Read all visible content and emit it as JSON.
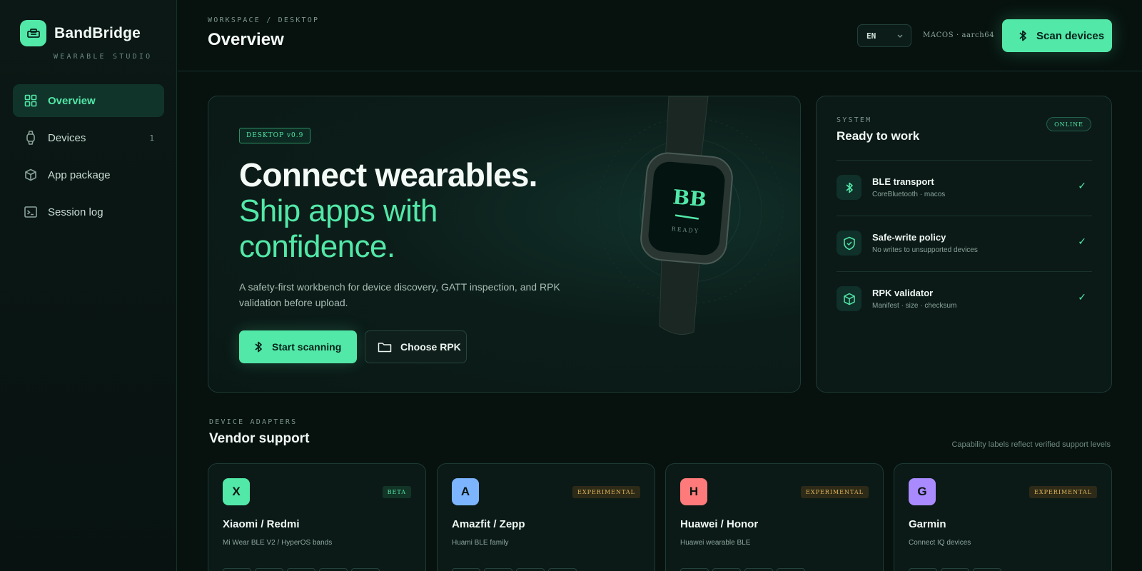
{
  "brand": {
    "name": "BandBridge",
    "subtitle": "WEARABLE STUDIO"
  },
  "sidebar": {
    "items": [
      {
        "label": "Overview",
        "icon": "grid-icon",
        "active": true
      },
      {
        "label": "Devices",
        "icon": "watch-icon",
        "count": "1"
      },
      {
        "label": "App package",
        "icon": "package-icon"
      },
      {
        "label": "Session log",
        "icon": "terminal-icon"
      }
    ]
  },
  "header": {
    "breadcrumb": "WORKSPACE / DESKTOP",
    "title": "Overview",
    "language": "EN",
    "platform": "MACOS · aarch64",
    "scan_label": "Scan devices"
  },
  "hero": {
    "badge": "DESKTOP v0.9",
    "headline": "Connect wearables.",
    "subheadline": "Ship apps with confidence.",
    "description": "A safety-first workbench for device discovery, GATT inspection, and RPK validation before upload.",
    "primary_label": "Start scanning",
    "secondary_label": "Choose RPK",
    "watch_logo": "BB",
    "watch_status": "READY"
  },
  "system": {
    "label": "SYSTEM",
    "title": "Ready to work",
    "status": "ONLINE",
    "items": [
      {
        "name": "BLE transport",
        "sub": "CoreBluetooth · macos",
        "icon": "bluetooth-icon",
        "check": "✓"
      },
      {
        "name": "Safe-write policy",
        "sub": "No writes to unsupported devices",
        "icon": "shield-check-icon",
        "check": "✓"
      },
      {
        "name": "RPK validator",
        "sub": "Manifest · size · checksum",
        "icon": "cube-icon",
        "check": "✓"
      }
    ]
  },
  "vendors": {
    "label": "DEVICE ADAPTERS",
    "title": "Vendor support",
    "note": "Capability labels reflect verified support levels",
    "cards": [
      {
        "letter": "X",
        "name": "Xiaomi / Redmi",
        "desc": "Mi Wear BLE V2 / HyperOS bands",
        "tag": "BETA",
        "color": "#52e8a8"
      },
      {
        "letter": "A",
        "name": "Amazfit / Zepp",
        "desc": "Huami BLE family",
        "tag": "EXPERIMENTAL",
        "color": "#7cb4ff"
      },
      {
        "letter": "H",
        "name": "Huawei / Honor",
        "desc": "Huawei wearable BLE",
        "tag": "EXPERIMENTAL",
        "color": "#ff7a7a"
      },
      {
        "letter": "G",
        "name": "Garmin",
        "desc": "Connect IQ devices",
        "tag": "EXPERIMENTAL",
        "color": "#a98bff"
      }
    ]
  },
  "colors": {
    "accent": "#52e8a8",
    "background": "#07120f",
    "warning": "#e2b95a"
  }
}
